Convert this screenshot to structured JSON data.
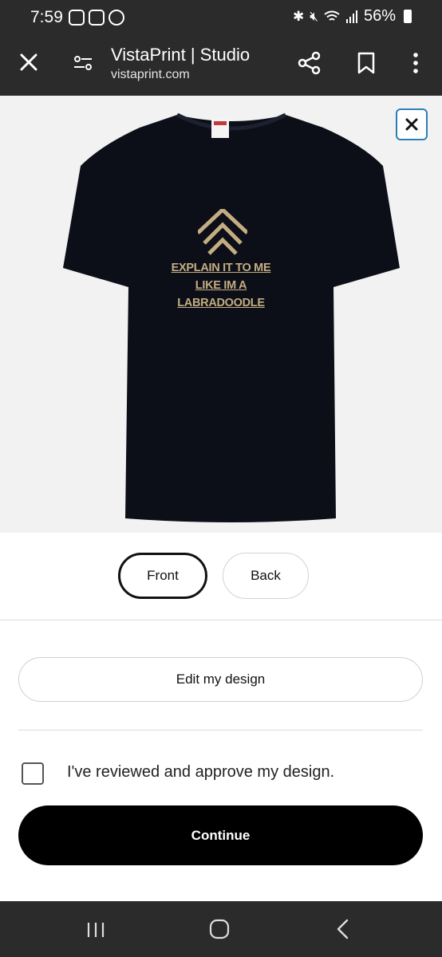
{
  "status_bar": {
    "time": "7:59",
    "battery": "56%",
    "icons_left": [
      "chat-icon",
      "shield-icon",
      "coin-icon"
    ],
    "icons_right": [
      "bluetooth-icon",
      "mute-icon",
      "wifi-icon",
      "signal-icon",
      "battery-icon"
    ]
  },
  "header": {
    "title": "VistaPrint | Studio",
    "url": "vistaprint.com"
  },
  "preview": {
    "design_text_line1": "EXPLAIN IT TO ME",
    "design_text_line2": "LIKE IM A",
    "design_text_line3": "LABRADOODLE",
    "shirt_color": "#0c0f18",
    "design_color": "#c4ad82"
  },
  "view_toggle": {
    "front": "Front",
    "back": "Back",
    "selected": "Front"
  },
  "actions": {
    "edit_label": "Edit my design",
    "approve_label": "I've reviewed and approve my design.",
    "approve_checked": false,
    "continue_label": "Continue"
  }
}
